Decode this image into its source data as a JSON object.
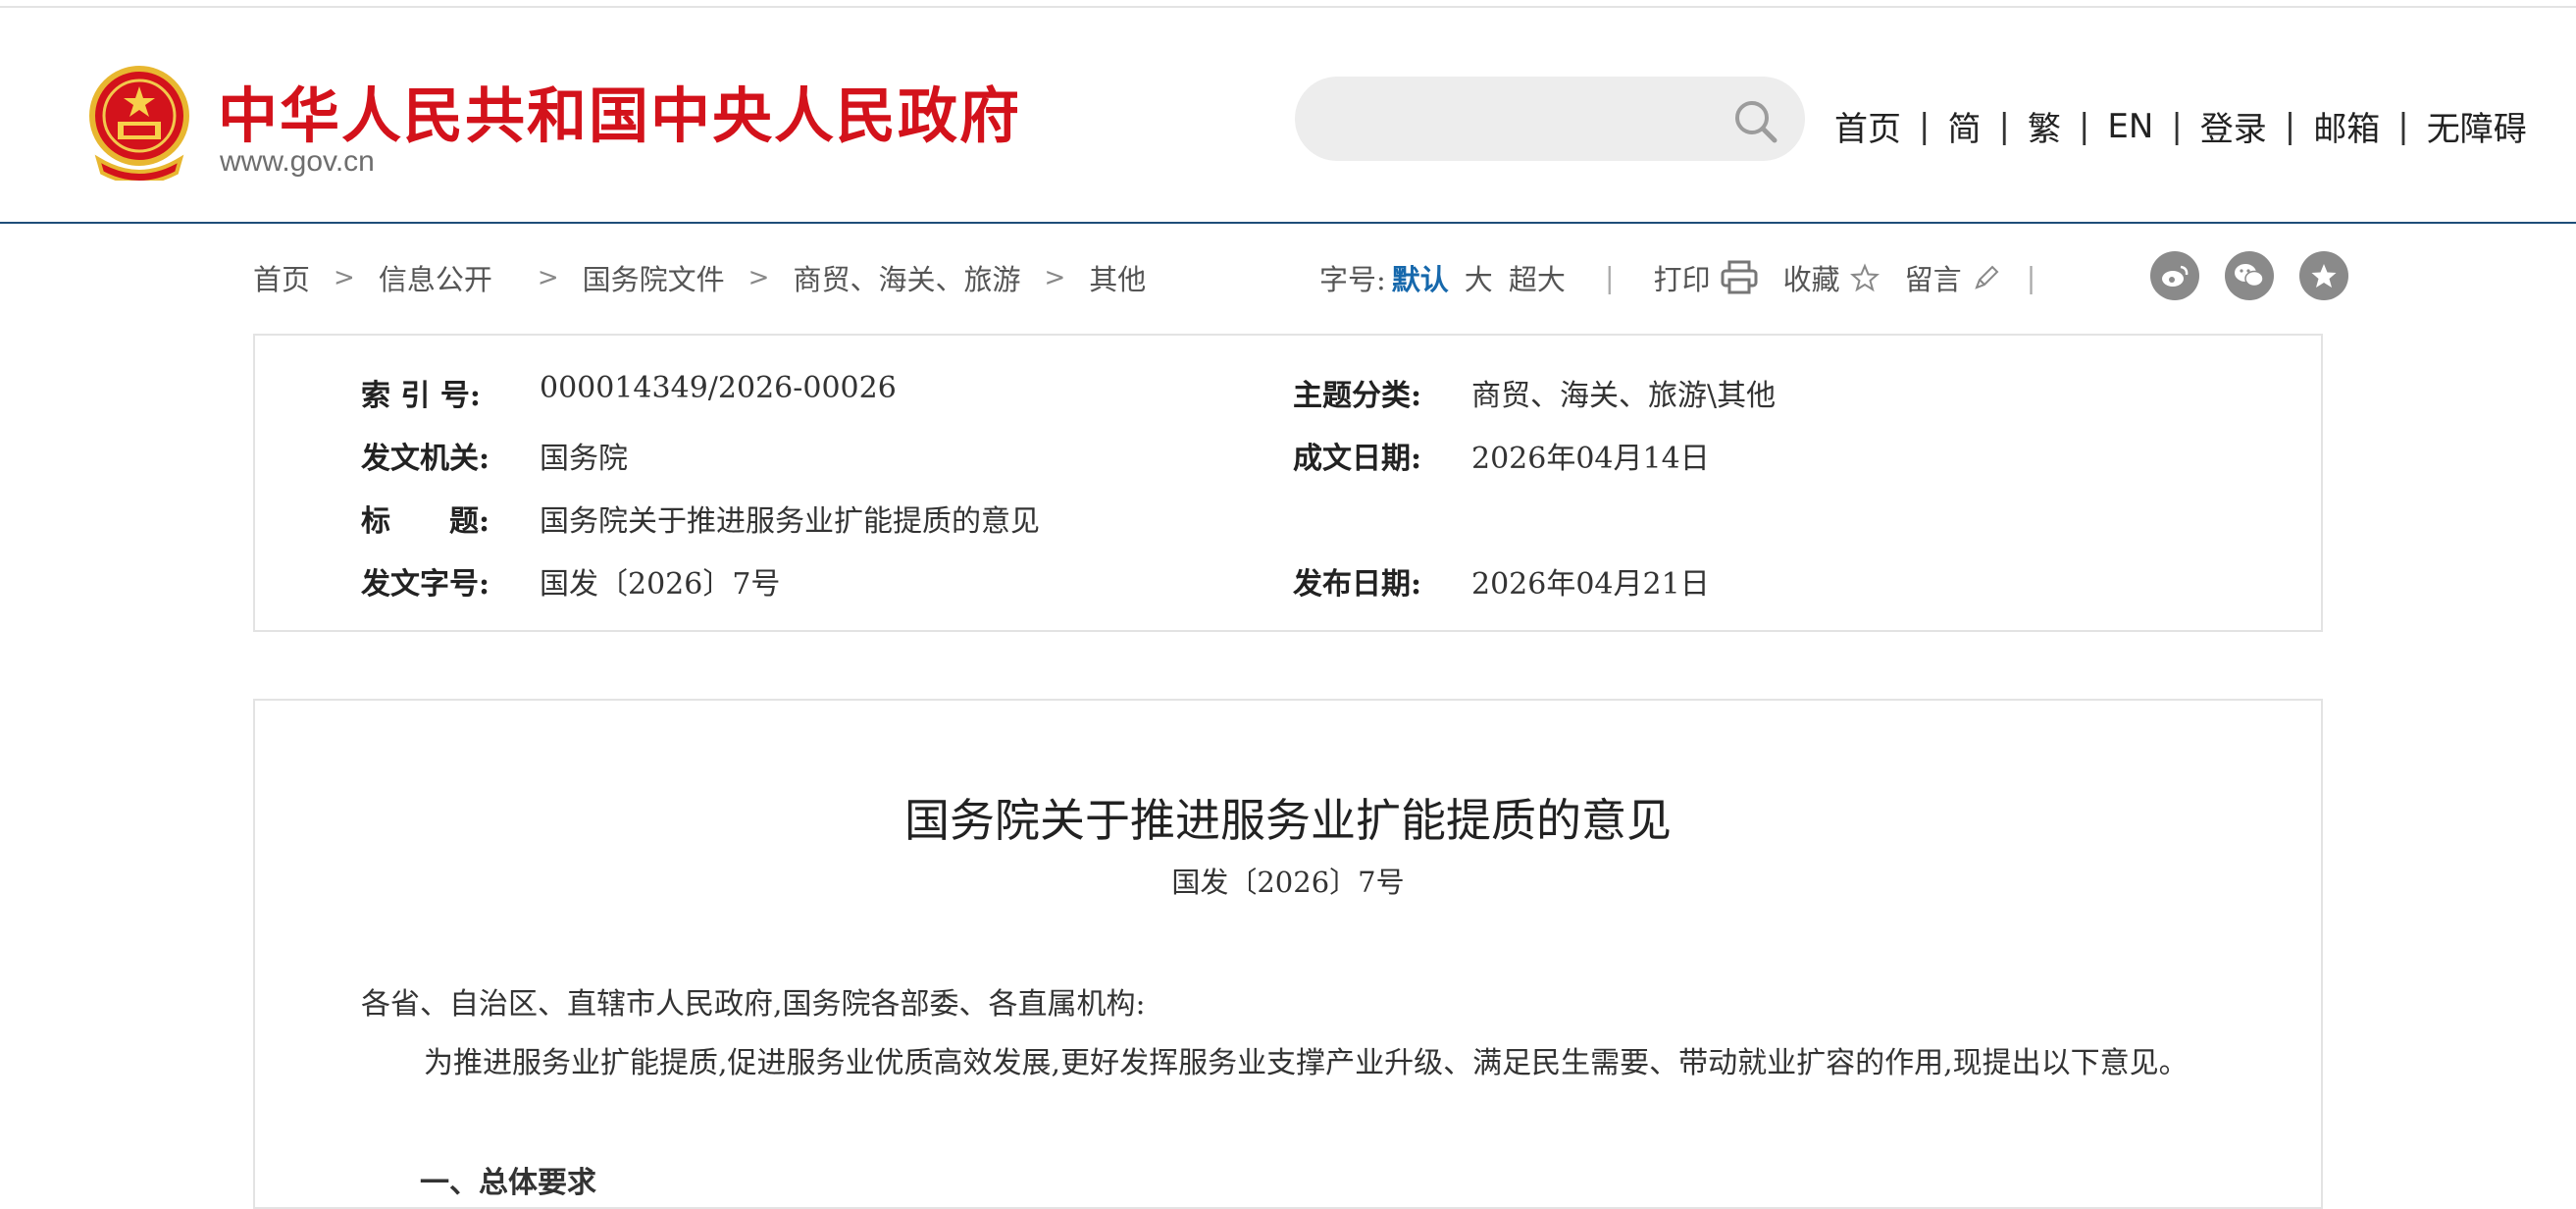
{
  "site": {
    "title": "中华人民共和国中央人民政府",
    "url": "www.gov.cn"
  },
  "search": {
    "placeholder": ""
  },
  "topnav": [
    "首页",
    "简",
    "繁",
    "EN",
    "登录",
    "邮箱",
    "无障碍"
  ],
  "breadcrumb": [
    "首页",
    "信息公开",
    "国务院文件",
    "商贸、海关、旅游",
    "其他"
  ],
  "tools": {
    "font_label": "字号:",
    "font_default": "默认",
    "font_large": "大",
    "font_xlarge": "超大",
    "print": "打印",
    "favorite": "收藏",
    "comment": "留言"
  },
  "social_icons": [
    "weibo-icon",
    "wechat-icon",
    "star-icon"
  ],
  "meta": {
    "index_label": "索 引 号:",
    "index_value": "000014349/2026-00026",
    "topic_label": "主题分类:",
    "topic_value": "商贸、海关、旅游\\其他",
    "issuer_label": "发文机关:",
    "issuer_value": "国务院",
    "written_label": "成文日期:",
    "written_value": "2026年04月14日",
    "title_label": "标　　题:",
    "title_value": "国务院关于推进服务业扩能提质的意见",
    "docno_label": "发文字号:",
    "docno_value": "国发〔2026〕7号",
    "published_label": "发布日期:",
    "published_value": "2026年04月21日"
  },
  "document": {
    "title": "国务院关于推进服务业扩能提质的意见",
    "number": "国发〔2026〕7号",
    "salutation": "各省、自治区、直辖市人民政府,国务院各部委、各直属机构:",
    "paragraph1": "为推进服务业扩能提质,促进服务业优质高效发展,更好发挥服务业支撑产业升级、满足民生需要、带动就业扩容的作用,现提出以下意见。",
    "heading1": "一、总体要求"
  },
  "colors": {
    "brand_red": "#d3121b",
    "accent_blue": "#1668ac",
    "header_line": "#1f4e79"
  }
}
